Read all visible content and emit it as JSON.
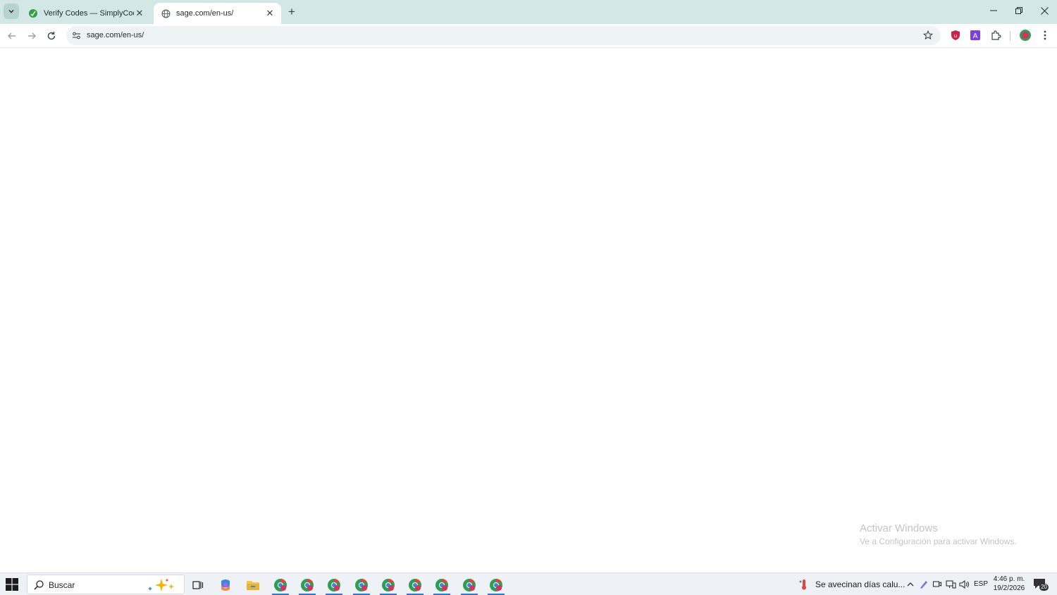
{
  "browser": {
    "tabs": [
      {
        "title": "Verify Codes — SimplyCodes",
        "active": false,
        "favicon": "simplycodes-leaf-icon"
      },
      {
        "title": "sage.com/en-us/",
        "active": true,
        "favicon": "globe-icon"
      }
    ],
    "address": {
      "url": "sage.com/en-us/"
    },
    "colors": {
      "tabstrip": "#d3e7e6",
      "omnibox": "#eef3f3",
      "accent": "#2a7ad8"
    }
  },
  "page": {
    "watermark": {
      "title": "Activar Windows",
      "subtitle": "Ve a Configuración para activar Windows."
    }
  },
  "taskbar": {
    "search_label": "Buscar",
    "weather_text": "Se avecinan días calu...",
    "language": "ESP",
    "time": "4:46 p. m.",
    "date": "19/2/2026",
    "notification_count": "20",
    "apps": [
      "task-view-icon",
      "copilot-icon",
      "file-explorer-icon",
      "chrome-icon",
      "chrome-icon",
      "chrome-icon",
      "chrome-icon",
      "chrome-icon",
      "chrome-icon",
      "chrome-icon",
      "chrome-icon",
      "chrome-icon"
    ]
  }
}
